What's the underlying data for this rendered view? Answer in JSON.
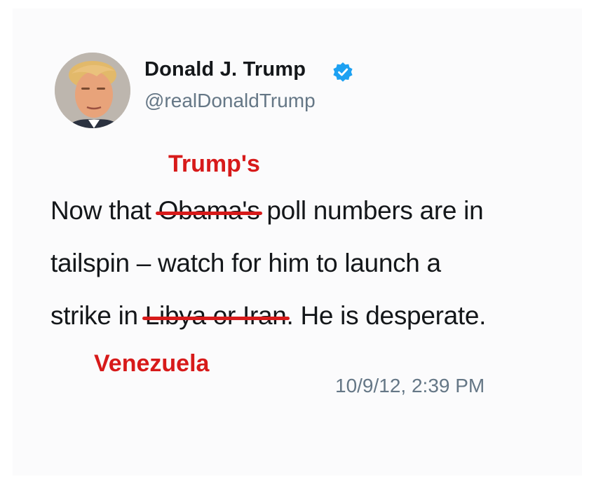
{
  "tweet": {
    "display_name": "Donald J. Trump",
    "handle": "@realDonaldTrump",
    "avatar_icon": "profile-photo-icon",
    "verified_icon": "verified-badge-icon",
    "verified_color": "#1da1f2",
    "text": {
      "line1_prefix": "Now that ",
      "line1_struck": "Obama's",
      "line1_suffix": " poll numbers are in",
      "line2": "tailspin – watch for him to launch a",
      "line3_prefix": "strike in ",
      "line3_struck": "Libya or Iran",
      "line3_suffix": ". He is desperate."
    },
    "timestamp": "10/9/12, 2:39 PM"
  },
  "annotations": {
    "color": "#d71a1a",
    "correction_1": "Trump's",
    "correction_2": "Venezuela"
  }
}
